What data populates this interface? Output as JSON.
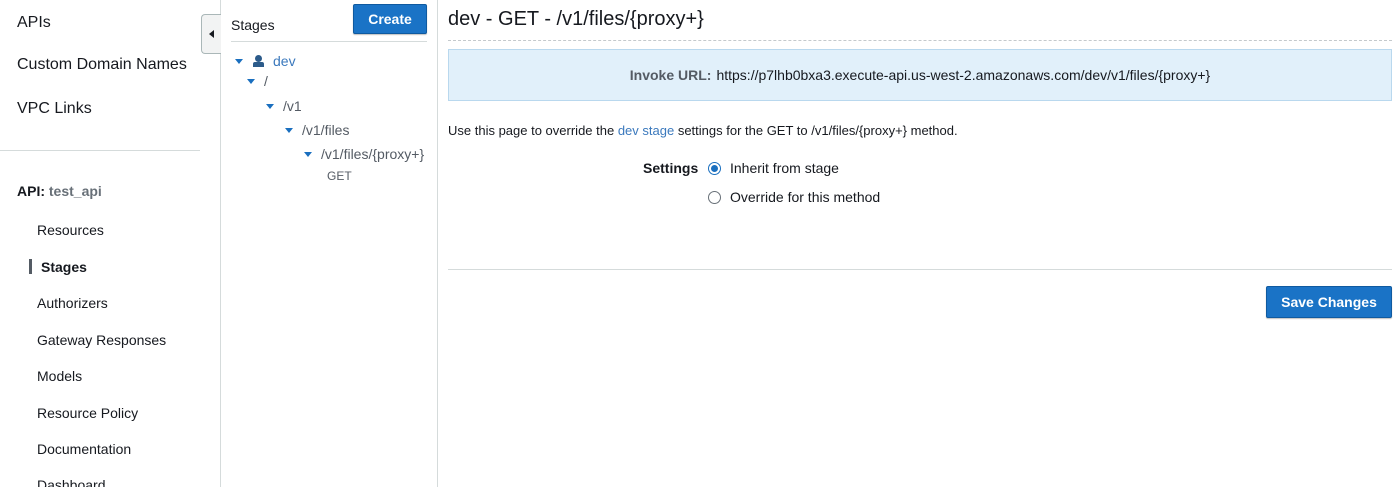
{
  "nav": {
    "top_items": [
      {
        "label": "APIs"
      },
      {
        "label": "Custom Domain Names"
      },
      {
        "label": "VPC Links"
      }
    ],
    "api_heading": {
      "label": "API:",
      "name": "test_api"
    },
    "sub_items": [
      {
        "label": "Resources"
      },
      {
        "label": "Stages",
        "active": true
      },
      {
        "label": "Authorizers"
      },
      {
        "label": "Gateway Responses"
      },
      {
        "label": "Models"
      },
      {
        "label": "Resource Policy"
      },
      {
        "label": "Documentation"
      },
      {
        "label": "Dashboard"
      }
    ]
  },
  "stages_panel": {
    "title": "Stages",
    "create_label": "Create",
    "tree": [
      {
        "label": "dev",
        "icon": "stage-icon"
      },
      {
        "label": "/"
      },
      {
        "label": "/v1"
      },
      {
        "label": "/v1/files"
      },
      {
        "label": "/v1/files/{proxy+}"
      },
      {
        "label": "GET"
      }
    ]
  },
  "main": {
    "title": "dev - GET - /v1/files/{proxy+}",
    "invoke": {
      "label": "Invoke URL:",
      "url": "https://p7lhb0bxa3.execute-api.us-west-2.amazonaws.com/dev/v1/files/{proxy+}"
    },
    "description": {
      "before": "Use this page to override the ",
      "link": "dev stage",
      "after": " settings for the GET to /v1/files/{proxy+} method."
    },
    "settings": {
      "label": "Settings",
      "options": [
        {
          "label": "Inherit from stage",
          "checked": true
        },
        {
          "label": "Override for this method",
          "checked": false
        }
      ]
    },
    "save_label": "Save Changes"
  },
  "colors": {
    "accent": "#1a73c6",
    "link": "#3b79bd",
    "info_bg": "#e1f0fa"
  }
}
